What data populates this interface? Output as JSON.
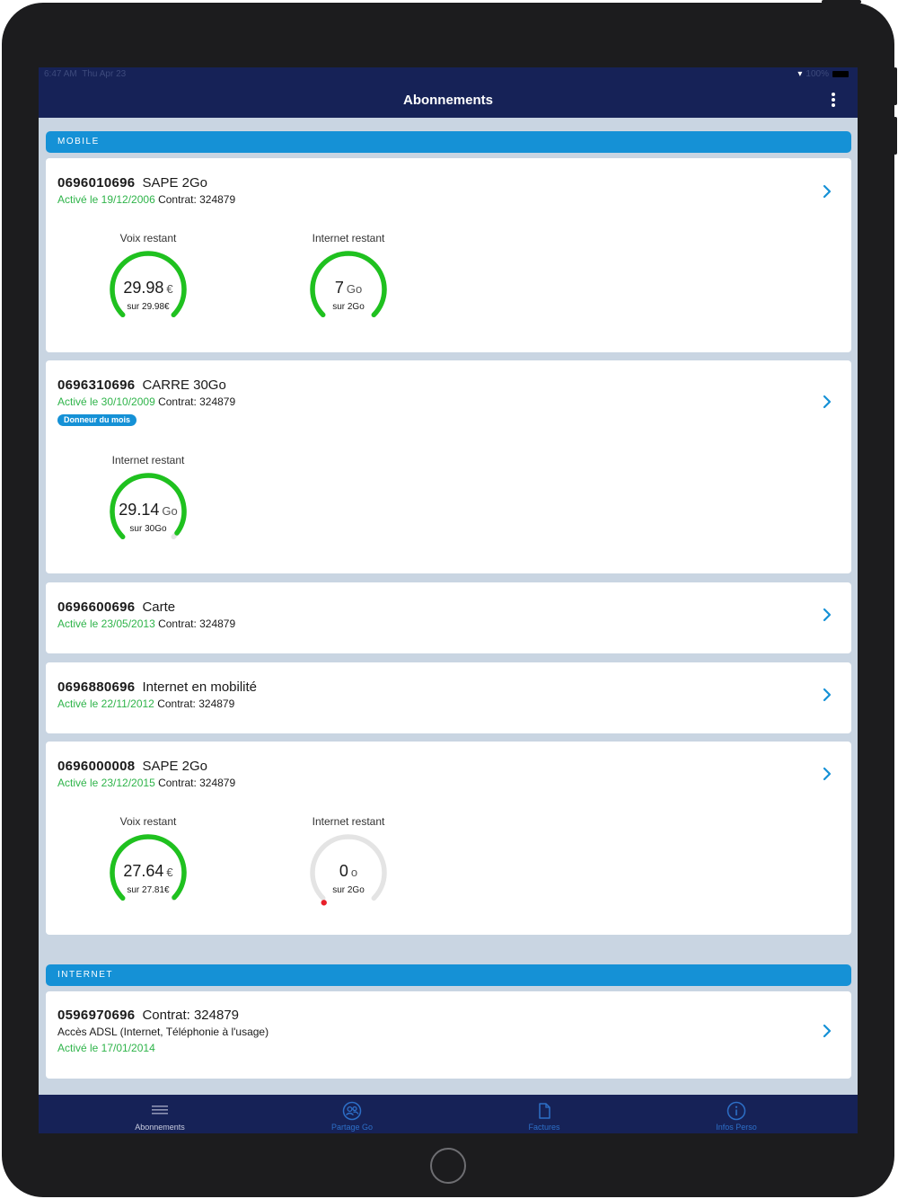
{
  "status_bar": {
    "time": "6:47 AM",
    "date": "Thu Apr 23",
    "battery": "100%"
  },
  "header": {
    "title": "Abonnements"
  },
  "sections": [
    {
      "title": "MOBILE"
    },
    {
      "title": "INTERNET"
    }
  ],
  "lines": [
    {
      "number": "0696010696",
      "plan": "SAPE 2Go",
      "activated": "Activé le 19/12/2006",
      "contract": "Contrat: 324879",
      "gauges": [
        {
          "label": "Voix restant",
          "value": "29.98",
          "unit": "€",
          "subtitle": "sur 29.98€",
          "fraction": 1.0
        },
        {
          "label": "Internet restant",
          "value": "7",
          "unit": "Go",
          "subtitle": "sur 2Go",
          "fraction": 1.0
        }
      ]
    },
    {
      "number": "0696310696",
      "plan": "CARRE 30Go",
      "activated": "Activé le 30/10/2009",
      "contract": "Contrat: 324879",
      "badge": "Donneur du mois",
      "gauges": [
        {
          "label": "Internet restant",
          "value": "29.14",
          "unit": "Go",
          "subtitle": "sur 30Go",
          "fraction": 0.97
        }
      ]
    },
    {
      "number": "0696600696",
      "plan": "Carte",
      "activated": "Activé le 23/05/2013",
      "contract": "Contrat: 324879"
    },
    {
      "number": "0696880696",
      "plan": "Internet en mobilité",
      "activated": "Activé le 22/11/2012",
      "contract": "Contrat: 324879"
    },
    {
      "number": "0696000008",
      "plan": "SAPE 2Go",
      "activated": "Activé le 23/12/2015",
      "contract": "Contrat: 324879",
      "gauges": [
        {
          "label": "Voix restant",
          "value": "27.64",
          "unit": "€",
          "subtitle": "sur 27.81€",
          "fraction": 0.994
        },
        {
          "label": "Internet restant",
          "value": "0",
          "unit": "o",
          "subtitle": "sur 2Go",
          "fraction": 0.0
        }
      ]
    }
  ],
  "internet_line": {
    "number": "0596970696",
    "contract": "Contrat: 324879",
    "description": "Accès ADSL (Internet, Téléphonie à l'usage)",
    "activated": "Activé le 17/01/2014"
  },
  "tabs": [
    {
      "label": "Abonnements",
      "icon": "menu-icon",
      "active": true
    },
    {
      "label": "Partage Go",
      "icon": "share-users-icon",
      "active": false
    },
    {
      "label": "Factures",
      "icon": "document-icon",
      "active": false
    },
    {
      "label": "Infos Perso",
      "icon": "info-icon",
      "active": false
    }
  ],
  "colors": {
    "navy": "#162257",
    "accent_blue": "#1591d6",
    "green": "#2fb44a",
    "gauge_green": "#1fc11f",
    "gauge_track": "#e4e4e4",
    "gauge_empty_dot": "#e8202a",
    "background": "#c9d5e2"
  }
}
